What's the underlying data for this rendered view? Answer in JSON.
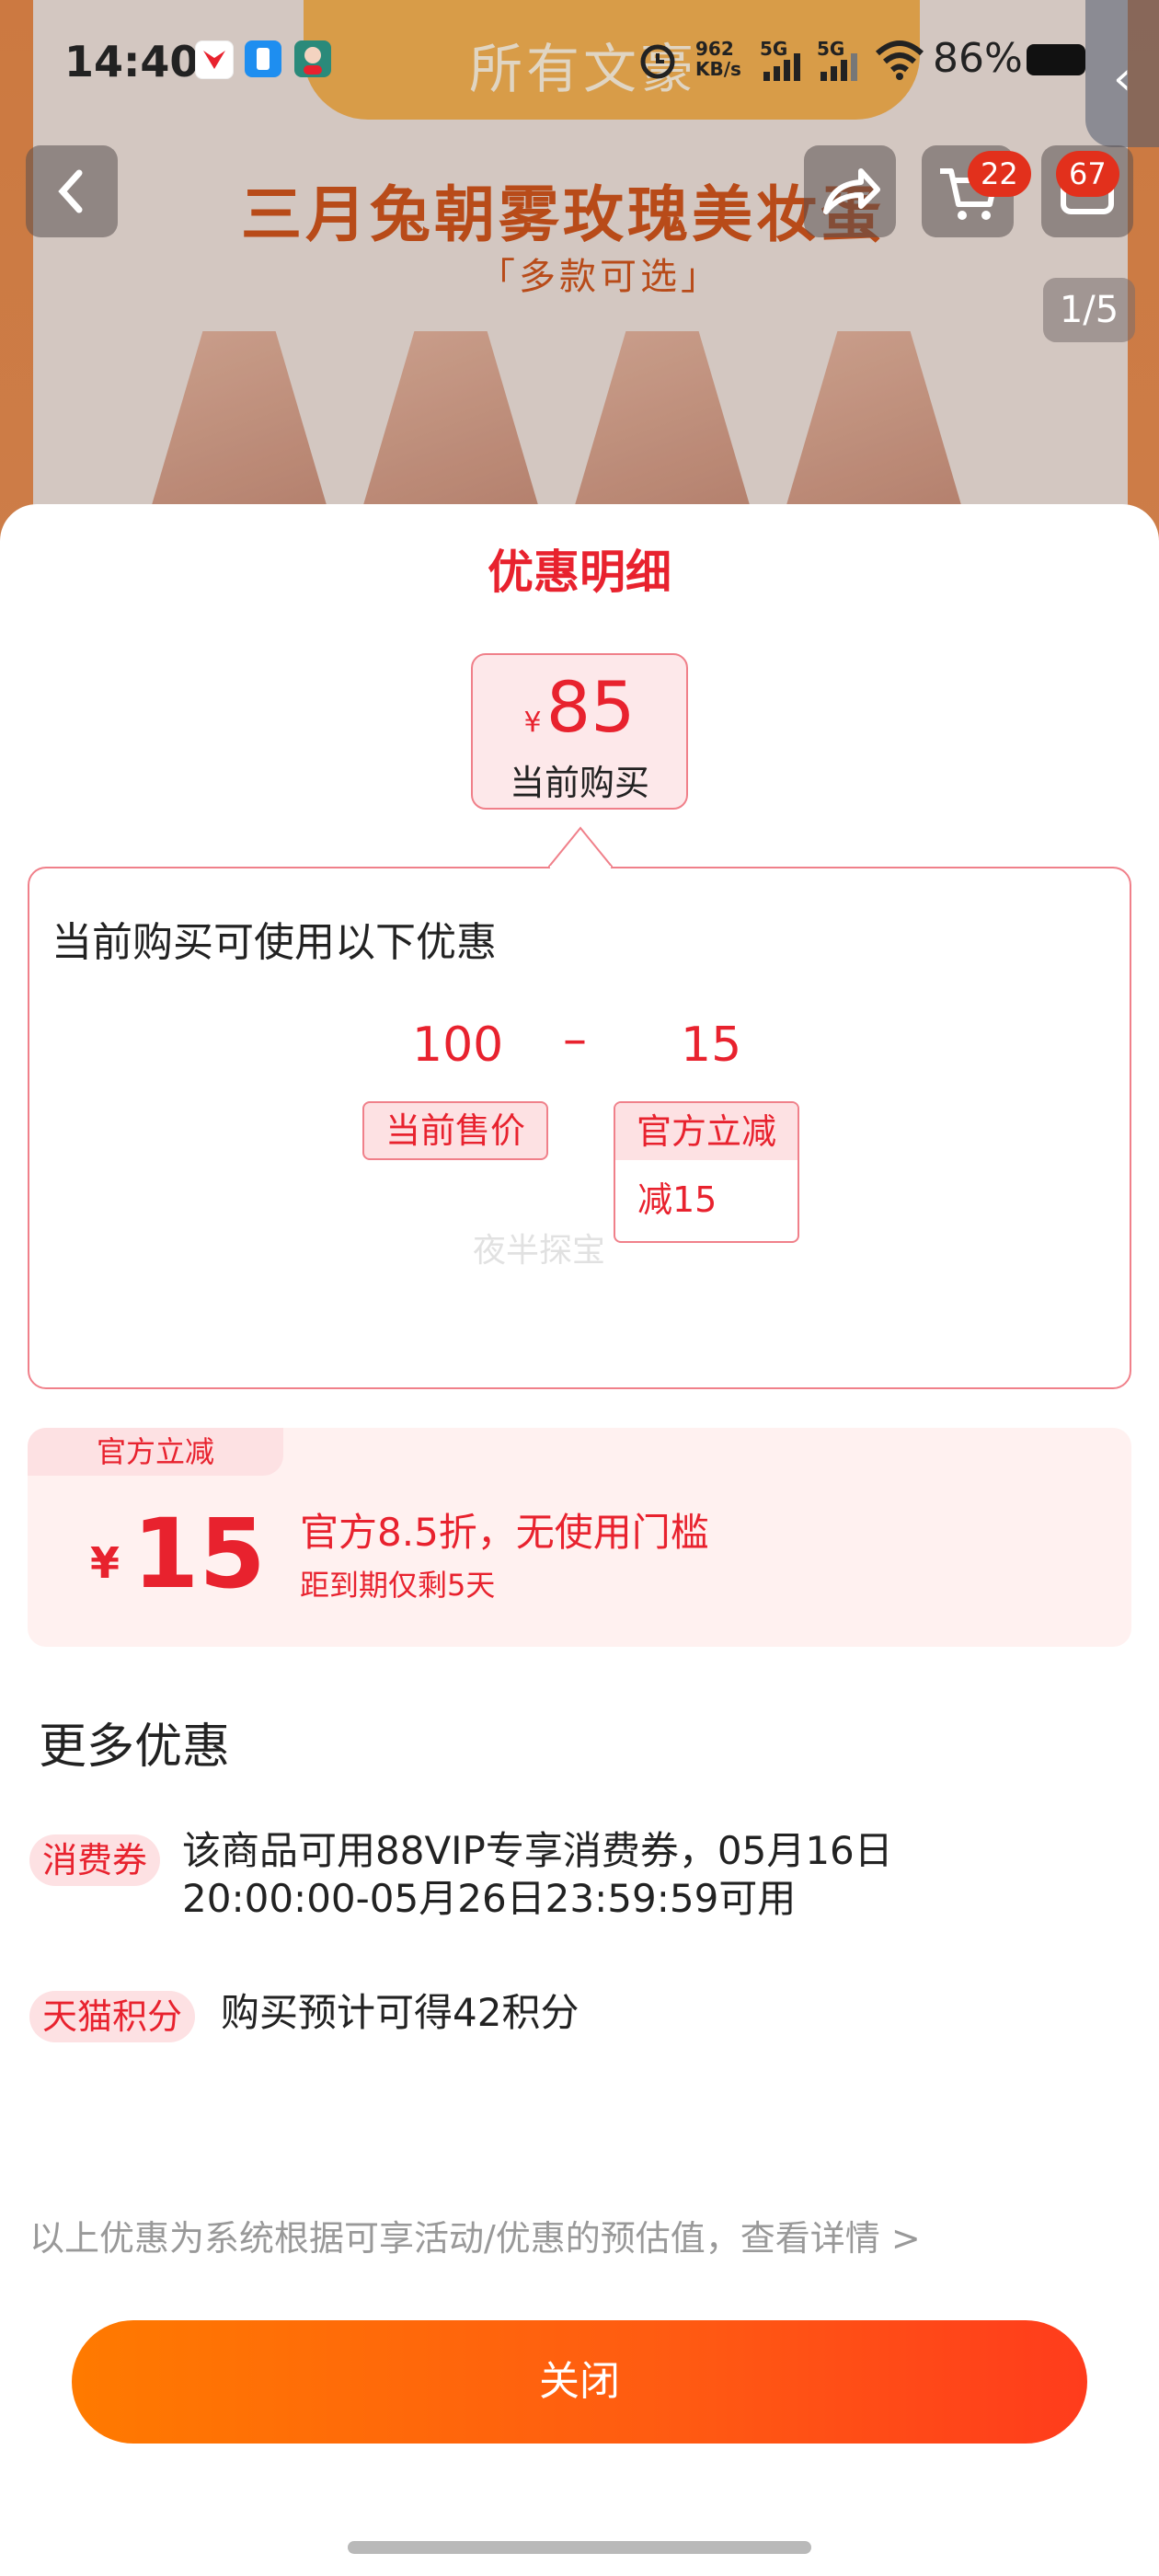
{
  "status_bar": {
    "time": "14:40",
    "net_speed_value": "962",
    "net_speed_unit": "KB/s",
    "sim1": "5G",
    "sim2": "5G",
    "battery": "86%"
  },
  "background_page": {
    "tab_label": "所有文豪",
    "product_title": "三月兔朝雾玫瑰美妆蛋",
    "product_subtitle": "「多款可选」",
    "cart_badge": "22",
    "message_badge": "67",
    "image_pager": "1/5"
  },
  "sheet": {
    "title": "优惠明细",
    "current_price": {
      "currency": "¥",
      "amount": "85",
      "label": "当前购买"
    },
    "detail": {
      "heading": "当前购买可使用以下优惠",
      "original_price": "100",
      "minus": "–",
      "discount_value": "15",
      "original_label": "当前售价",
      "discount_label": "官方立减",
      "discount_detail": "减15",
      "watermark": "夜半探宝"
    },
    "promo": {
      "tab": "官方立减",
      "currency": "¥",
      "amount": "15",
      "description": "官方8.5折，无使用门槛",
      "expiry": "距到期仅剩5天"
    },
    "more": {
      "title": "更多优惠",
      "items": [
        {
          "tag": "消费券",
          "text_line1": "该商品可用88VIP专享消费券，05月16日",
          "text_line2": "20:00:00-05月26日23:59:59可用"
        },
        {
          "tag": "天猫积分",
          "text_line1": "购买预计可得42积分"
        }
      ]
    },
    "disclaimer": "以上优惠为系统根据可享活动/优惠的预估值，查看详情 >",
    "close_button": "关闭"
  },
  "colors": {
    "accent_red": "#e8222e",
    "button_gradient_start": "#ff7a00",
    "button_gradient_end": "#ff3c1c",
    "promo_bg": "#fff1f0"
  }
}
